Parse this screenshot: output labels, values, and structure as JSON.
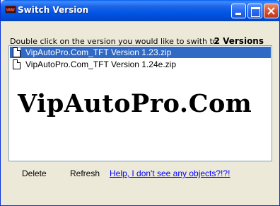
{
  "window": {
    "title": "Switch Version"
  },
  "header": {
    "instruction": "Double click on the version you would like to swith to.",
    "count": "2 Versions"
  },
  "list": {
    "items": [
      {
        "label": "VipAutoPro.Com_TFT Version 1.23.zip",
        "selected": true
      },
      {
        "label": "VipAutoPro.Com_TFT Version 1.24e.zip",
        "selected": false
      }
    ]
  },
  "watermark": "VipAutoPro.Com",
  "footer": {
    "delete_label": "Delete",
    "refresh_label": "Refresh",
    "help_label": "Help, I don't see any objects?!?!"
  },
  "colors": {
    "selection": "#316AC5",
    "link": "#0000FF"
  }
}
